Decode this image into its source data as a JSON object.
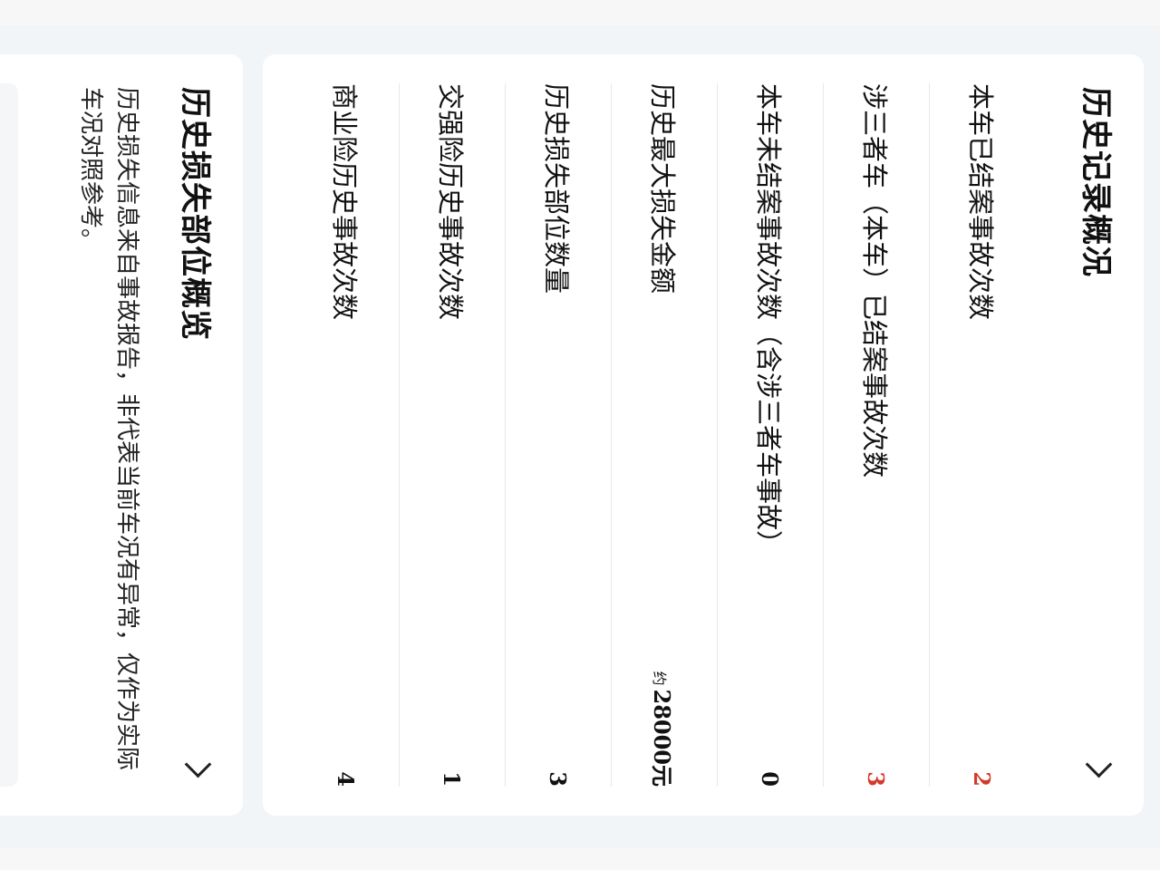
{
  "history": {
    "title": "历史记录概况",
    "rows": [
      {
        "label": "本车已结案事故次数",
        "value": "2",
        "alert": true
      },
      {
        "label": "涉三者车（本车）已结案事故次数",
        "value": "3",
        "alert": true
      },
      {
        "label": "本车未结案事故次数（含涉三者车事故）",
        "value": "0",
        "alert": false
      },
      {
        "label": "历史最大损失金额",
        "prefix": "约",
        "value": "28000元",
        "alert": false
      },
      {
        "label": "历史损失部位数量",
        "value": "3",
        "alert": false
      },
      {
        "label": "交强险历史事故次数",
        "value": "1",
        "alert": false
      },
      {
        "label": "商业险历史事故次数",
        "value": "4",
        "alert": false
      }
    ]
  },
  "loss_parts": {
    "title": "历史损失部位概览",
    "description": "历史损失信息来自事故报告，非代表当前车况有异常，仅作为实际车况对照参考。"
  },
  "colors": {
    "alert": "#d23b2b",
    "background": "#f2f5f8"
  },
  "icons": {
    "chevron": "chevron-right-icon"
  }
}
